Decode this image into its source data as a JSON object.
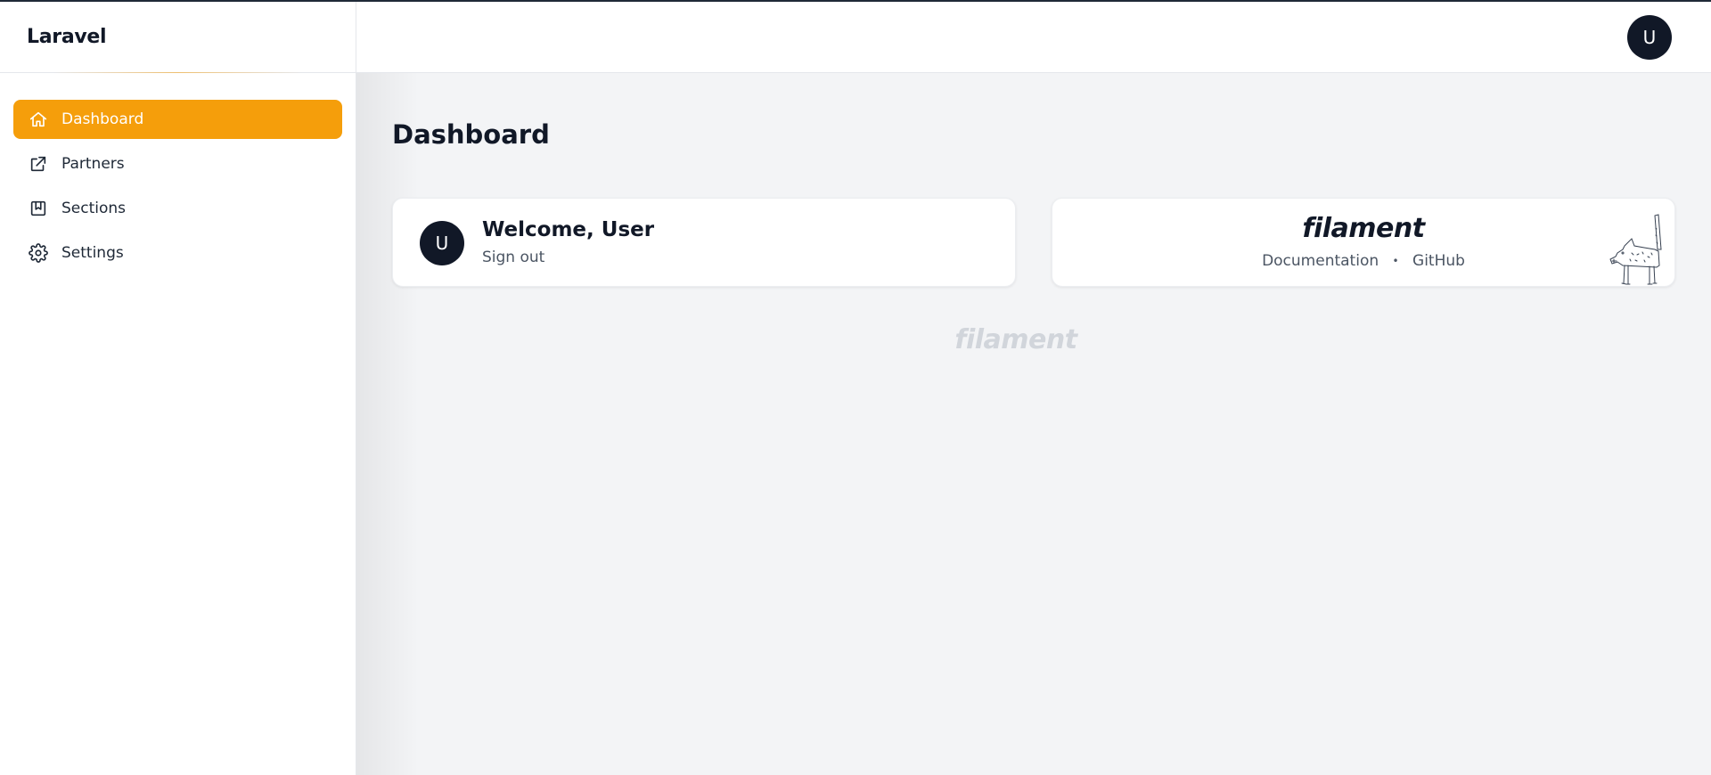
{
  "sidebar": {
    "brand": "Laravel",
    "items": [
      {
        "label": "Dashboard",
        "icon": "home-icon",
        "active": true
      },
      {
        "label": "Partners",
        "icon": "external-link-icon",
        "active": false
      },
      {
        "label": "Sections",
        "icon": "bookmark-square-icon",
        "active": false
      },
      {
        "label": "Settings",
        "icon": "gear-icon",
        "active": false
      }
    ]
  },
  "header": {
    "avatar_initial": "U"
  },
  "main": {
    "title": "Dashboard",
    "welcome_card": {
      "avatar_initial": "U",
      "greeting": "Welcome, User",
      "sign_out": "Sign out"
    },
    "filament_card": {
      "logo": "filament",
      "link_docs": "Documentation",
      "separator": "•",
      "link_github": "GitHub"
    },
    "footer_logo": "filament"
  },
  "colors": {
    "accent": "#f59e0b",
    "avatar_bg": "#111827",
    "page_bg": "#f3f4f6"
  }
}
